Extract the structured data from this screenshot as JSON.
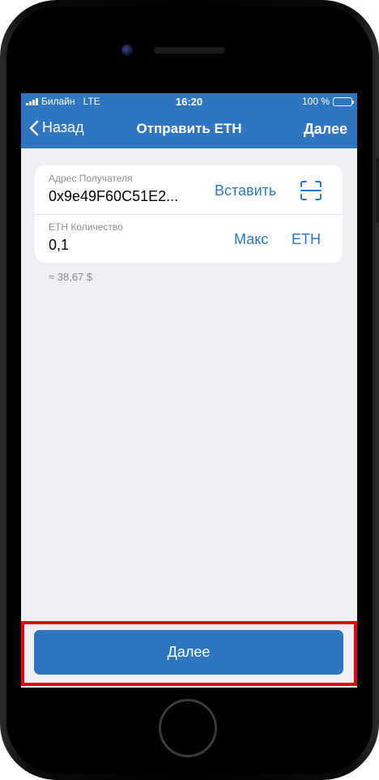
{
  "status_bar": {
    "carrier": "Билайн",
    "network": "LTE",
    "time": "16:20",
    "battery": "100 %"
  },
  "nav": {
    "back_label": "Назад",
    "title": "Отправить ETH",
    "next_label": "Далее"
  },
  "form": {
    "recipient": {
      "label": "Адрес Получателя",
      "value": "0x9e49F60C51E2...",
      "paste_label": "Вставить",
      "scan_icon": "qr-scan-icon"
    },
    "amount": {
      "label": "ETH Количество",
      "value": "0,1",
      "max_label": "Макс",
      "currency_label": "ETH"
    },
    "approx_fiat": "≈ 38,67 $"
  },
  "footer": {
    "submit_label": "Далее"
  },
  "colors": {
    "accent": "#2f76c0",
    "background": "#efeff4",
    "highlight": "#e8000f",
    "battery": "#4cd964"
  }
}
